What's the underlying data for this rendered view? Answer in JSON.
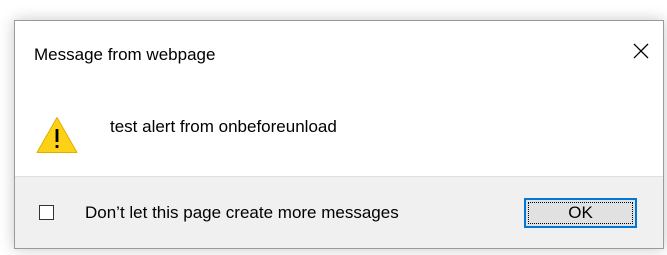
{
  "dialog": {
    "title": "Message from webpage",
    "message": "test alert from onbeforeunload",
    "icon": "warning-icon",
    "close_icon": "close-icon",
    "checkbox": {
      "label": "Don’t let this page create more messages",
      "checked": false
    },
    "ok_label": "OK"
  },
  "colors": {
    "warning_fill": "#FCD116",
    "warning_mark": "#000000",
    "footer_bg": "#f0f0f0",
    "button_bg": "#e1e1e1",
    "button_focus_border": "#0078d7"
  }
}
